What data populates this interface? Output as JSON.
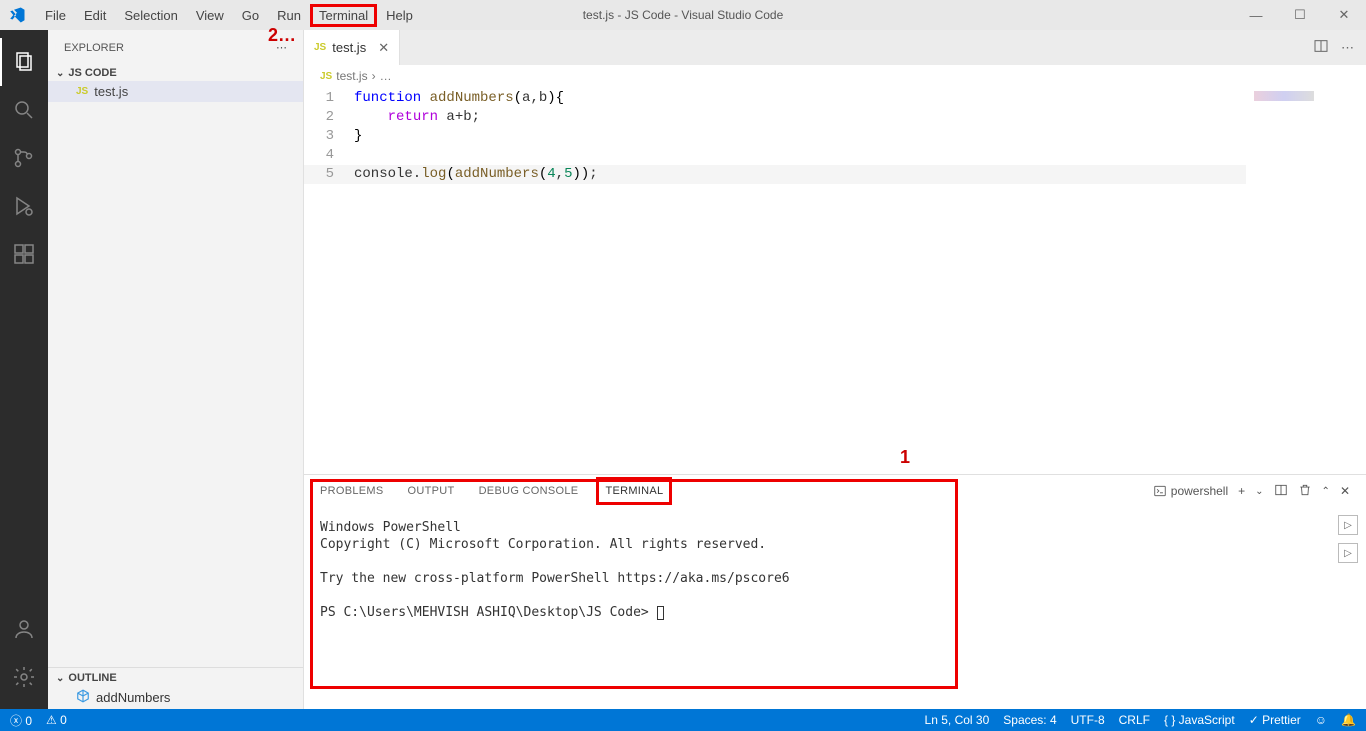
{
  "menu": {
    "items": [
      "File",
      "Edit",
      "Selection",
      "View",
      "Go",
      "Run",
      "Terminal",
      "Help"
    ],
    "highlighted": "Terminal"
  },
  "window": {
    "title": "test.js - JS Code - Visual Studio Code"
  },
  "annotations": {
    "one": "1",
    "two": "2",
    "ellipsis": "…"
  },
  "sidebar": {
    "title": "EXPLORER",
    "workspace": "JS CODE",
    "file_icon": "JS",
    "file_name": "test.js",
    "outline_title": "OUTLINE",
    "outline_item": "addNumbers"
  },
  "tabs": {
    "active_icon": "JS",
    "active_name": "test.js"
  },
  "breadcrumb": {
    "icon": "JS",
    "file": "test.js",
    "sep": "›",
    "rest": "…"
  },
  "code": {
    "lines": [
      {
        "n": "1",
        "html": "<span class='kw'>function</span> <span class='fn'>addNumbers</span><span class='br'>(</span>a,b<span class='br'>){</span>"
      },
      {
        "n": "2",
        "html": "    <span class='rt'>return</span> a+b;"
      },
      {
        "n": "3",
        "html": "<span class='br'>}</span>"
      },
      {
        "n": "4",
        "html": ""
      },
      {
        "n": "5",
        "html": "console.<span class='fn'>log</span><span class='br'>(</span><span class='fn'>addNumbers</span><span class='br'>(</span><span class='num'>4</span>,<span class='num'>5</span><span class='br'>))</span>;",
        "current": true
      }
    ]
  },
  "panel": {
    "tabs": [
      "PROBLEMS",
      "OUTPUT",
      "DEBUG CONSOLE",
      "TERMINAL"
    ],
    "active": "TERMINAL",
    "shell_label": "powershell"
  },
  "terminal": {
    "lines": [
      "Windows PowerShell",
      "Copyright (C) Microsoft Corporation. All rights reserved.",
      "",
      "Try the new cross-platform PowerShell https://aka.ms/pscore6",
      ""
    ],
    "prompt": "PS C:\\Users\\MEHVISH ASHIQ\\Desktop\\JS Code> "
  },
  "status": {
    "errors": "0",
    "warnings": "0",
    "ln_col": "Ln 5, Col 30",
    "spaces": "Spaces: 4",
    "encoding": "UTF-8",
    "eol": "CRLF",
    "lang": "JavaScript",
    "prettier": "Prettier"
  }
}
